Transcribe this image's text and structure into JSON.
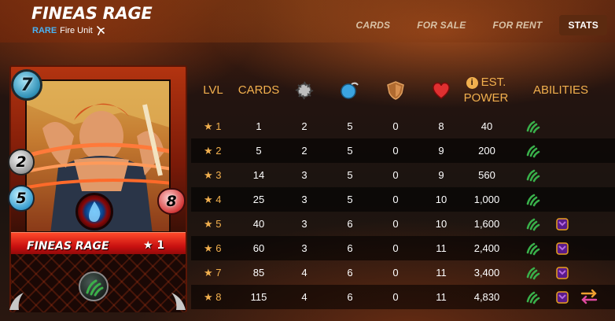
{
  "header": {
    "title": "FINEAS RAGE",
    "rarity": "RARE",
    "unit_type": "Fire Unit"
  },
  "nav": {
    "tabs": [
      {
        "label": "CARDS",
        "active": false
      },
      {
        "label": "FOR SALE",
        "active": false
      },
      {
        "label": "FOR RENT",
        "active": false
      },
      {
        "label": "STATS",
        "active": true
      }
    ]
  },
  "card": {
    "name": "FINEAS RAGE",
    "level": "★ 1",
    "mana": "7",
    "melee": "2",
    "speed": "5",
    "health": "8",
    "element": "water",
    "ability_icon": "claw-icon"
  },
  "table": {
    "headers": {
      "lvl": "LVL",
      "cards": "CARDS",
      "est_power": "EST.",
      "est_power_2": "POWER",
      "abilities": "ABILITIES",
      "info": "i"
    },
    "rows": [
      {
        "lvl": "★ 1",
        "cards": "1",
        "attack": "2",
        "speed": "5",
        "armor": "0",
        "health": "8",
        "power": "40",
        "abilities": [
          "claw-icon"
        ]
      },
      {
        "lvl": "★ 2",
        "cards": "5",
        "attack": "2",
        "speed": "5",
        "armor": "0",
        "health": "9",
        "power": "200",
        "abilities": [
          "claw-icon"
        ]
      },
      {
        "lvl": "★ 3",
        "cards": "14",
        "attack": "3",
        "speed": "5",
        "armor": "0",
        "health": "9",
        "power": "560",
        "abilities": [
          "claw-icon"
        ]
      },
      {
        "lvl": "★ 4",
        "cards": "25",
        "attack": "3",
        "speed": "5",
        "armor": "0",
        "health": "10",
        "power": "1,000",
        "abilities": [
          "claw-icon"
        ]
      },
      {
        "lvl": "★ 5",
        "cards": "40",
        "attack": "3",
        "speed": "6",
        "armor": "0",
        "health": "10",
        "power": "1,600",
        "abilities": [
          "claw-icon",
          "potion-icon"
        ]
      },
      {
        "lvl": "★ 6",
        "cards": "60",
        "attack": "3",
        "speed": "6",
        "armor": "0",
        "health": "11",
        "power": "2,400",
        "abilities": [
          "claw-icon",
          "potion-icon"
        ]
      },
      {
        "lvl": "★ 7",
        "cards": "85",
        "attack": "4",
        "speed": "6",
        "armor": "0",
        "health": "11",
        "power": "3,400",
        "abilities": [
          "claw-icon",
          "potion-icon"
        ]
      },
      {
        "lvl": "★ 8",
        "cards": "115",
        "attack": "4",
        "speed": "6",
        "armor": "0",
        "health": "11",
        "power": "4,830",
        "abilities": [
          "claw-icon",
          "potion-icon",
          "swap-arrows-icon"
        ]
      }
    ]
  },
  "colors": {
    "accent": "#f2b04e",
    "rarity": "#4ab3f4",
    "active_tab": "#5c2a10"
  }
}
